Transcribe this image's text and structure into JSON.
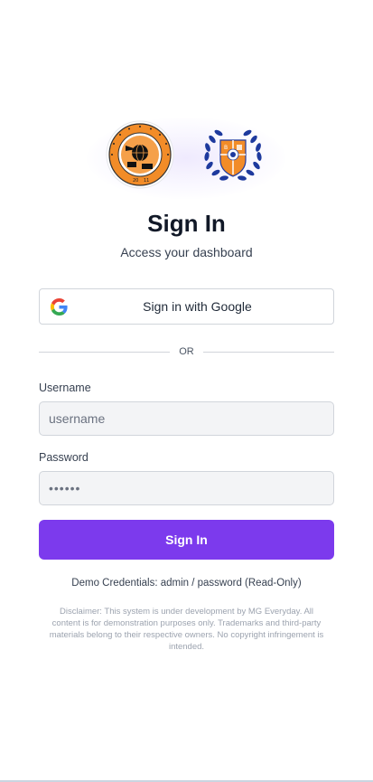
{
  "header": {
    "title": "Sign In",
    "subtitle": "Access your dashboard"
  },
  "logos": [
    {
      "name": "institute-seal-orange",
      "text": "INSTITUTE OF SCIENCE IN TOURISM MANAGEMENT"
    },
    {
      "name": "laurel-crest-blue-orange"
    }
  ],
  "google": {
    "icon": "google-icon",
    "label": "Sign in with Google"
  },
  "divider": {
    "label": "OR"
  },
  "form": {
    "username_label": "Username",
    "username_placeholder": "username",
    "password_label": "Password",
    "password_value": "••••••",
    "submit_label": "Sign In"
  },
  "demo_note": "Demo Credentials: admin / password (Read-Only)",
  "disclaimer": "Disclaimer: This system is under development by MG Everyday. All content is for demonstration purposes only. Trademarks and third-party materials belong to their respective owners. No copyright infringement is intended.",
  "colors": {
    "primary": "#7c3aed",
    "seal_orange": "#f28c28",
    "crest_blue": "#1e3a9e"
  }
}
